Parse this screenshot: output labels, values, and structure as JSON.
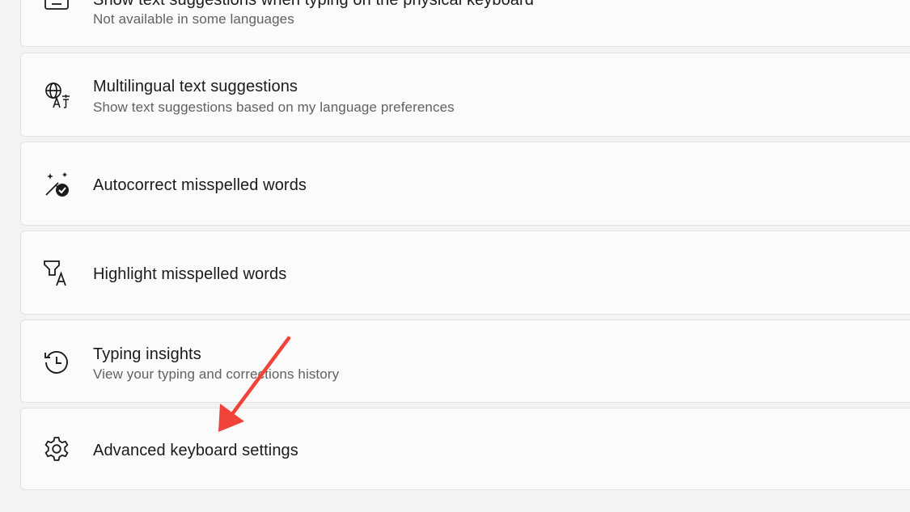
{
  "settings": {
    "items": [
      {
        "title": "Show text suggestions when typing on the physical keyboard",
        "subtitle": "Not available in some languages",
        "icon": "keyboard-icon"
      },
      {
        "title": "Multilingual text suggestions",
        "subtitle": "Show text suggestions based on my language preferences",
        "icon": "language-icon"
      },
      {
        "title": "Autocorrect misspelled words",
        "subtitle": "",
        "icon": "autocorrect-icon"
      },
      {
        "title": "Highlight misspelled words",
        "subtitle": "",
        "icon": "highlight-text-icon"
      },
      {
        "title": "Typing insights",
        "subtitle": "View your typing and corrections history",
        "icon": "history-icon"
      },
      {
        "title": "Advanced keyboard settings",
        "subtitle": "",
        "icon": "gear-icon"
      }
    ]
  },
  "annotation": {
    "arrow_color": "#f0433a",
    "points_to": "Advanced keyboard settings"
  }
}
